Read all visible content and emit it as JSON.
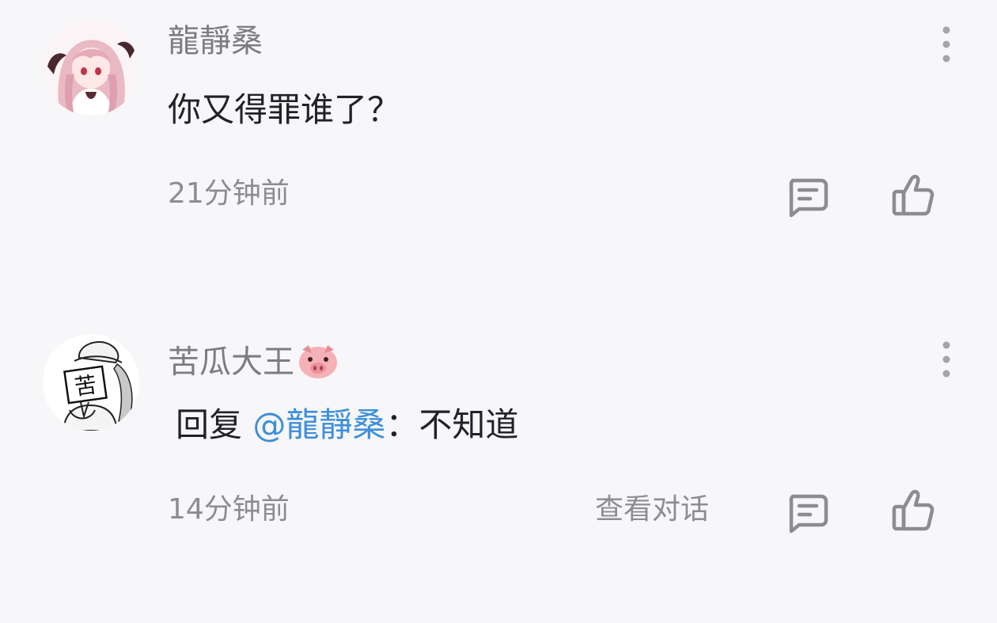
{
  "comments": [
    {
      "username": "龍靜桑",
      "text": "你又得罪谁了？",
      "time": "21分钟前"
    },
    {
      "username": "苦瓜大王",
      "username_emoji": "pig-face-icon",
      "reply_prefix": "回复 ",
      "mention": "@龍靜桑",
      "reply_sep": "：",
      "text": "不知道",
      "time": "14分钟前",
      "view_conversation": "查看对话",
      "avatar_glyph": "苦"
    }
  ],
  "colors": {
    "background": "#f7f6f8",
    "username": "#7d7c82",
    "text": "#222226",
    "meta": "#8d8c92",
    "mention": "#3d8fd9",
    "icon": "#8d8c92"
  }
}
